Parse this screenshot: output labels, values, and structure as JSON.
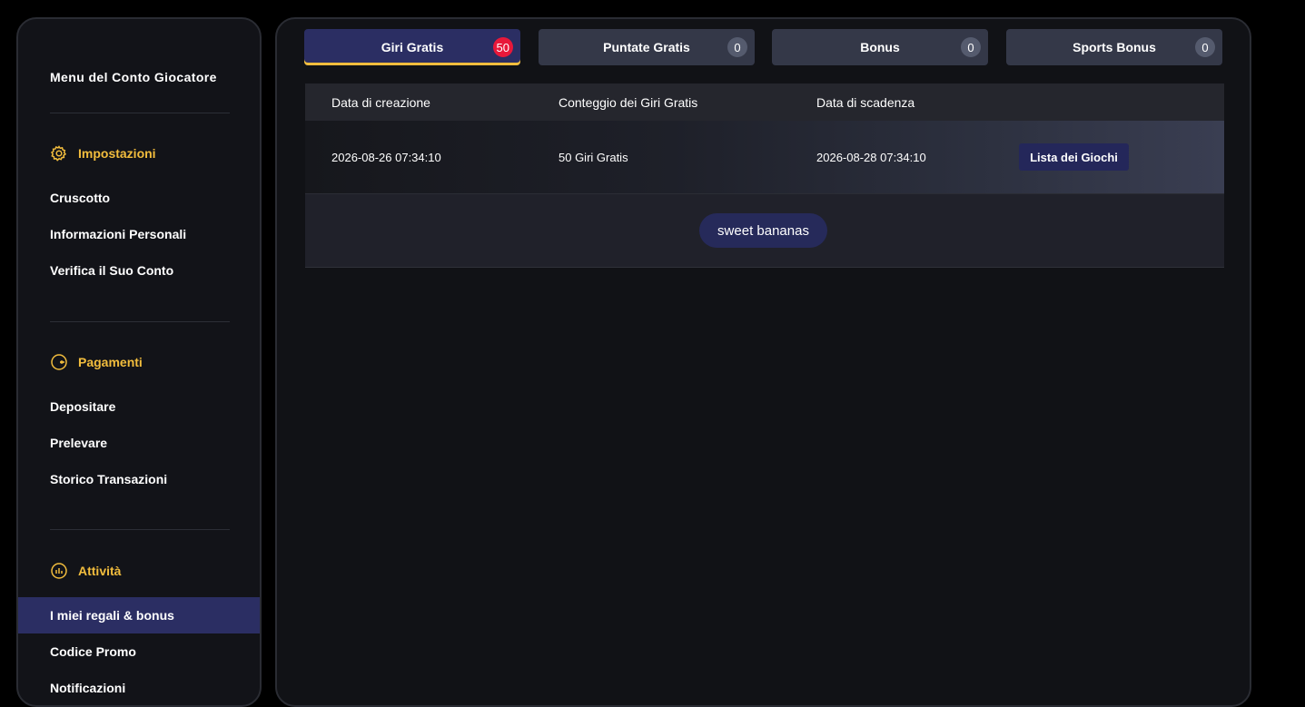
{
  "sidebar": {
    "title": "Menu del Conto Giocatore",
    "sections": [
      {
        "heading": "Impostazioni",
        "icon": "gear-icon",
        "items": [
          {
            "label": "Cruscotto"
          },
          {
            "label": "Informazioni Personali"
          },
          {
            "label": "Verifica il Suo Conto"
          }
        ]
      },
      {
        "heading": "Pagamenti",
        "icon": "wallet-icon",
        "items": [
          {
            "label": "Depositare"
          },
          {
            "label": "Prelevare"
          },
          {
            "label": "Storico Transazioni"
          }
        ]
      },
      {
        "heading": "Attività",
        "icon": "activity-icon",
        "items": [
          {
            "label": "I miei regali & bonus",
            "active": true
          },
          {
            "label": "Codice Promo"
          },
          {
            "label": "Notificazioni"
          }
        ]
      }
    ]
  },
  "tabs": [
    {
      "label": "Giri Gratis",
      "count": "50",
      "active": true
    },
    {
      "label": "Puntate Gratis",
      "count": "0"
    },
    {
      "label": "Bonus",
      "count": "0"
    },
    {
      "label": "Sports Bonus",
      "count": "0"
    }
  ],
  "table": {
    "headers": [
      "Data di creazione",
      "Conteggio dei Giri Gratis",
      "Data di scadenza"
    ],
    "rows": [
      {
        "created": "2026-08-26 07:34:10",
        "count": "50 Giri Gratis",
        "expires": "2026-08-28 07:34:10",
        "action": "Lista dei Giochi",
        "games": [
          "sweet bananas"
        ]
      }
    ]
  },
  "colors": {
    "accent": "#f2bd3d",
    "active_bg": "#2b2e63",
    "badge_active": "#e8183a"
  }
}
